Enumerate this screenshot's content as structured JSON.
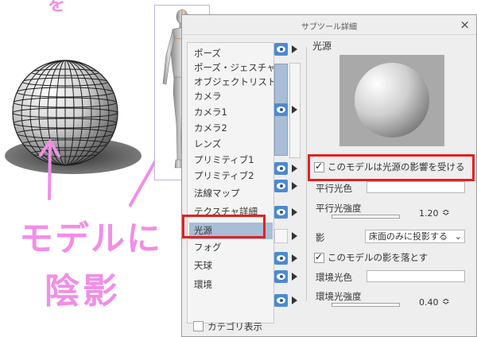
{
  "annotation": {
    "top_fragment": "を",
    "line1": "モデルに",
    "line2": "陰影"
  },
  "dialog": {
    "title": "サブツール詳細",
    "close_label": "×",
    "categories": [
      {
        "label": "ポーズ",
        "visible": true
      },
      {
        "label": "ポーズ・ジェスチャー",
        "visible": false
      },
      {
        "label": "オブジェクトリスト",
        "visible": false
      },
      {
        "label": "カメラ",
        "visible": false
      },
      {
        "label": "カメラ1",
        "visible": false
      },
      {
        "label": "カメラ2",
        "visible": false
      },
      {
        "label": "レンズ",
        "visible": false
      },
      {
        "label": "プリミティブ1",
        "visible": true
      },
      {
        "label": "プリミティブ2",
        "visible": true
      },
      {
        "label": "法線マップ",
        "visible": true
      },
      {
        "label": "テクスチャ詳細",
        "visible": true
      },
      {
        "label": "光源",
        "visible": false
      },
      {
        "label": "フォグ",
        "visible": true
      },
      {
        "label": "天球",
        "visible": true
      },
      {
        "label": "環境",
        "visible": true
      }
    ],
    "category_display_label": "カテゴリ表示",
    "section_title": "光源",
    "receive_light_label": "このモデルは光源の影響を受ける",
    "parallel_light_color_label": "平行光色",
    "parallel_light_intensity_label": "平行光強度",
    "parallel_light_intensity_value": "1.20",
    "shadow_label": "影",
    "shadow_select_value": "床面のみに投影する",
    "cast_shadow_label": "このモデルの影を落とす",
    "ambient_color_label": "環境光色",
    "ambient_intensity_label": "環境光強度",
    "ambient_intensity_value": "0.40"
  },
  "colors": {
    "annotation": "#f18ee6",
    "highlight": "#e52020",
    "selection": "#a8bed6",
    "eye": "#4c8ad2"
  }
}
